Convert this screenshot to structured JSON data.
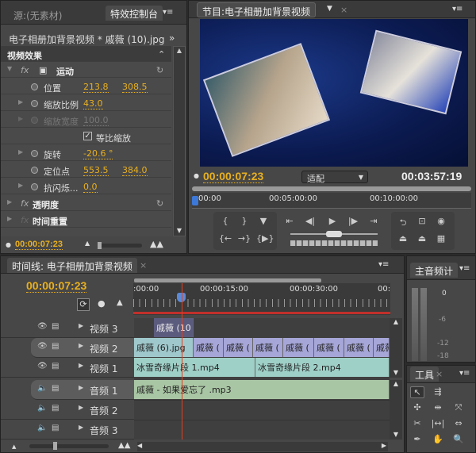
{
  "effect_controls": {
    "source_tab": "源:(无素材)",
    "tab": "特效控制台",
    "clip_title": "电子相册加背景视频 * 戚薇 (10).jpg",
    "section": "视频效果",
    "motion": "运动",
    "position_label": "位置",
    "position_x": "213.8",
    "position_y": "308.5",
    "scale_label": "缩放比例",
    "scale": "43.0",
    "scale_width_label": "缩放宽度",
    "scale_width": "100.0",
    "uniform_scale": "等比缩放",
    "uniform_scale_checked": true,
    "rotation_label": "旋转",
    "rotation": "-20.6 °",
    "anchor_label": "定位点",
    "anchor_x": "553.5",
    "anchor_y": "384.0",
    "antiflicker_label": "抗闪烁...",
    "antiflicker": "0.0",
    "opacity": "透明度",
    "time_remap": "时间重置",
    "timecode": "00:00:07:23"
  },
  "program": {
    "tab": "节目:电子相册加背景视频",
    "timecode": "00:00:07:23",
    "fit": "适配",
    "duration": "00:03:57:19",
    "ruler": [
      "00:00",
      "00:05:00:00",
      "00:10:00:00"
    ]
  },
  "timeline": {
    "tab": "时间线: 电子相册加背景视频",
    "timecode": "00:00:07:23",
    "ruler": [
      ":00:00",
      "00:00:15:00",
      "00:00:30:00",
      "00:"
    ],
    "tracks": {
      "v3": "视频 3",
      "v2": "视频 2",
      "v1": "视频 1",
      "a1": "音频 1",
      "a2": "音频 2",
      "a3": "音频 3"
    },
    "clips": {
      "v3": "戚薇 (10",
      "v2": [
        "戚薇 (6).jpg",
        "戚薇 (",
        "戚薇 (",
        "戚薇 (",
        "戚薇 (",
        "戚薇 (",
        "戚薇 (",
        "戚薇"
      ],
      "v1": [
        "冰雪奇缘片段 1.mp4",
        "冰雪奇缘片段 2.mp4"
      ],
      "a1": "戚薇 - 如果爱忘了 .mp3"
    }
  },
  "audio_master": {
    "tab": "主音频计",
    "scale": [
      "0",
      "-6",
      "-12",
      "-18"
    ]
  },
  "tools": {
    "tab": "工具"
  },
  "colors": {
    "timecode": "#e8b020",
    "playhead": "#e04020",
    "video_clip": "#9fd0c8",
    "image_clip": "#a6a6d8",
    "audio_clip": "#a9c6a4"
  }
}
